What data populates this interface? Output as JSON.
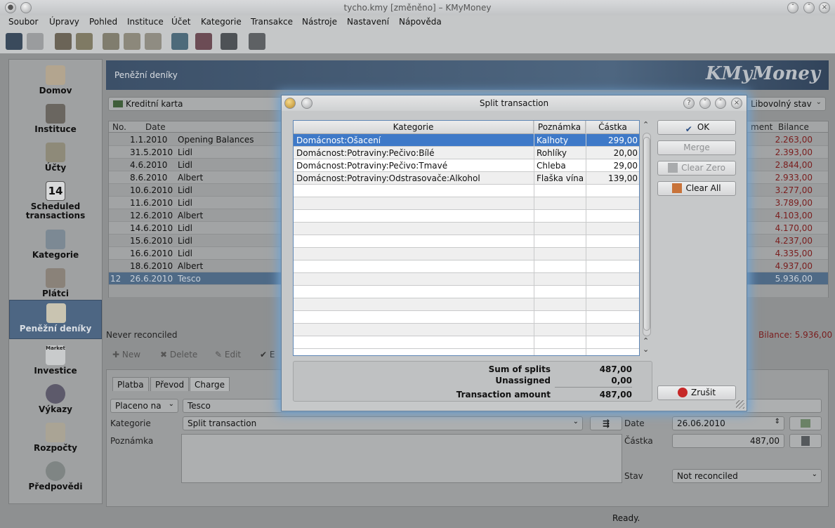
{
  "window": {
    "title": "tycho.kmy [změněno] – KMyMoney"
  },
  "menu": [
    "Soubor",
    "Úpravy",
    "Pohled",
    "Instituce",
    "Účet",
    "Kategorie",
    "Transakce",
    "Nástroje",
    "Nastavení",
    "Nápověda"
  ],
  "sidebar": [
    {
      "label": "Domov",
      "icon": "house-icon"
    },
    {
      "label": "Instituce",
      "icon": "bank-icon"
    },
    {
      "label": "Účty",
      "icon": "coins-icon"
    },
    {
      "label": "Scheduled transactions",
      "icon": "calendar-icon",
      "calendar_day": "14"
    },
    {
      "label": "Kategorie",
      "icon": "folder-icon"
    },
    {
      "label": "Plátci",
      "icon": "people-icon"
    },
    {
      "label": "Peněžní deníky",
      "icon": "ledger-icon",
      "selected": true
    },
    {
      "label": "Investice",
      "icon": "market-chart-icon",
      "icon_text": "Market"
    },
    {
      "label": "Výkazy",
      "icon": "pie-chart-icon"
    },
    {
      "label": "Rozpočty",
      "icon": "budget-icon"
    },
    {
      "label": "Předpovědi",
      "icon": "crystal-ball-icon"
    }
  ],
  "main": {
    "header_title": "Peněžní deníky",
    "logo": "KMyMoney",
    "account": "Kreditní karta",
    "status_filter": "Libovolný stav",
    "columns": {
      "no": "No.",
      "date": "Date",
      "payment": "ment",
      "balance": "Bilance"
    },
    "rows": [
      {
        "no": "",
        "date": "1.1.2010",
        "payee": "Opening Balances",
        "balance": "2.263,00"
      },
      {
        "no": "",
        "date": "31.5.2010",
        "payee": "Lidl",
        "balance": "2.393,00"
      },
      {
        "no": "",
        "date": "4.6.2010",
        "payee": "Lidl",
        "balance": "2.844,00"
      },
      {
        "no": "",
        "date": "8.6.2010",
        "payee": "Albert",
        "balance": "2.933,00"
      },
      {
        "no": "",
        "date": "10.6.2010",
        "payee": "Lidl",
        "balance": "3.277,00"
      },
      {
        "no": "",
        "date": "11.6.2010",
        "payee": "Lidl",
        "balance": "3.789,00"
      },
      {
        "no": "",
        "date": "12.6.2010",
        "payee": "Albert",
        "balance": "4.103,00"
      },
      {
        "no": "",
        "date": "14.6.2010",
        "payee": "Lidl",
        "balance": "4.170,00"
      },
      {
        "no": "",
        "date": "15.6.2010",
        "payee": "Lidl",
        "balance": "4.237,00"
      },
      {
        "no": "",
        "date": "16.6.2010",
        "payee": "Lidl",
        "balance": "4.335,00"
      },
      {
        "no": "",
        "date": "18.6.2010",
        "payee": "Albert",
        "balance": "4.937,00"
      },
      {
        "no": "12",
        "date": "26.6.2010",
        "payee": "Tesco",
        "balance": "5.936,00",
        "selected": true
      }
    ],
    "reconcile_status": "Never reconciled",
    "bilance_total": "Bilance: 5.936,00",
    "actions": {
      "new": "New",
      "delete": "Delete",
      "edit": "Edit",
      "enter": "E"
    },
    "form": {
      "tabs": [
        "Platba",
        "Převod",
        "Charge"
      ],
      "pay_to_label": "Placeno na",
      "payee": "Tesco",
      "category_label": "Kategorie",
      "category": "Split transaction",
      "memo_label": "Poznámka",
      "date_label": "Date",
      "date": "26.06.2010",
      "amount_label": "Částka",
      "amount": "487,00",
      "state_label": "Stav",
      "state": "Not reconciled"
    },
    "statusbar": "Ready."
  },
  "dialog": {
    "title": "Split transaction",
    "columns": {
      "category": "Kategorie",
      "memo": "Poznámka",
      "amount": "Částka"
    },
    "splits": [
      {
        "category": "Domácnost:Ošacení",
        "memo": "Kalhoty",
        "amount": "299,00",
        "selected": true
      },
      {
        "category": "Domácnost:Potraviny:Pečivo:Bílé",
        "memo": "Rohlíky",
        "amount": "20,00"
      },
      {
        "category": "Domácnost:Potraviny:Pečivo:Tmavé",
        "memo": "Chleba",
        "amount": "29,00"
      },
      {
        "category": "Domácnost:Potraviny:Odstrasovače:Alkohol",
        "memo": "Flaška vína",
        "amount": "139,00"
      }
    ],
    "buttons": {
      "ok": "OK",
      "merge": "Merge",
      "clear_zero": "Clear Zero",
      "clear_all": "Clear All",
      "cancel": "Zrušit"
    },
    "summary": {
      "sum_label": "Sum of splits",
      "sum": "487,00",
      "unassigned_label": "Unassigned",
      "unassigned": "0,00",
      "amount_label": "Transaction amount",
      "amount": "487,00"
    }
  }
}
